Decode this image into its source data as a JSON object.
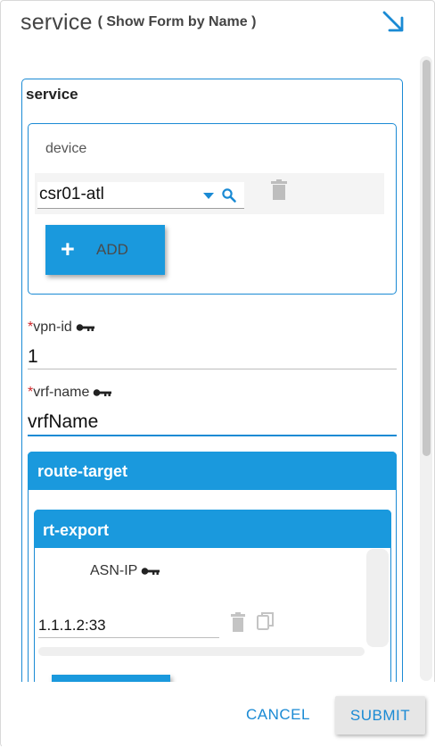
{
  "header": {
    "title": "service",
    "subtitle": "( Show Form by Name )",
    "collapse_icon": "arrow-down-right-icon"
  },
  "form": {
    "section_label": "service",
    "device": {
      "label": "device",
      "value": "csr01-atl",
      "add_label": "ADD"
    },
    "vpn_id": {
      "required_mark": "*",
      "label": "vpn-id",
      "value": "1"
    },
    "vrf_name": {
      "required_mark": "*",
      "label": "vrf-name",
      "value": "vrfName"
    },
    "route_target": {
      "label": "route-target",
      "rt_export": {
        "label": "rt-export",
        "asn_ip_label": "ASN-IP",
        "asn_ip_value": "1.1.1.2:33"
      }
    }
  },
  "footer": {
    "cancel_label": "CANCEL",
    "submit_label": "SUBMIT"
  },
  "colors": {
    "accent": "#1a99dd",
    "border": "#1a8ad4",
    "required": "#d0262a"
  }
}
